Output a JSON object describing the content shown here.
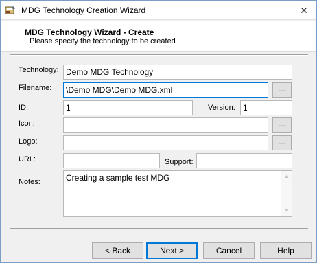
{
  "window": {
    "title": "MDG Technology Creation Wizard",
    "close_glyph": "✕"
  },
  "header": {
    "title": "MDG Technology Wizard - Create",
    "subtitle": "Please specify the technology to be created"
  },
  "form": {
    "technology": {
      "label": "Technology:",
      "value": "Demo MDG Technology"
    },
    "filename": {
      "label": "Filename:",
      "value": "\\Demo MDG\\Demo MDG.xml",
      "browse": "..."
    },
    "id": {
      "label": "ID:",
      "value": "1"
    },
    "version": {
      "label": "Version:",
      "value": "1"
    },
    "icon": {
      "label": "Icon:",
      "value": "",
      "browse": "..."
    },
    "logo": {
      "label": "Logo:",
      "value": "",
      "browse": "..."
    },
    "url": {
      "label": "URL:",
      "value": ""
    },
    "support": {
      "label": "Support:",
      "value": ""
    },
    "notes": {
      "label": "Notes:",
      "value": "Creating a sample test MDG"
    }
  },
  "buttons": {
    "back": "< Back",
    "next": "Next >",
    "cancel": "Cancel",
    "help": "Help"
  },
  "icons": {
    "title_icon": "wizard-app-icon",
    "close": "close-icon",
    "scroll_up": "scroll-up-arrow-icon",
    "scroll_down": "scroll-down-arrow-icon"
  },
  "colors": {
    "focus_border": "#0078d7",
    "dialog_bg": "#f0f0f0"
  }
}
